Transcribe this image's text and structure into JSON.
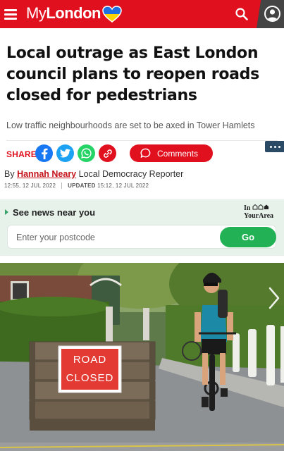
{
  "header": {
    "brand_my": "My",
    "brand_london": "London",
    "menu_icon": "hamburger-menu-icon",
    "search_icon": "search-icon",
    "account_icon": "user-account-icon",
    "brand_color": "#e0101e"
  },
  "article": {
    "headline": "Local outrage as East London council plans to reopen roads closed for pedestrians",
    "subheadline": "Low traffic neighbourhoods are set to be axed in Tower Hamlets",
    "byline_prefix": "By",
    "author": "Hannah Neary",
    "author_role": "Local Democracy Reporter",
    "published": "12:55, 12 JUL 2022",
    "updated_label": "UPDATED",
    "updated": "15:12, 12 JUL 2022"
  },
  "share": {
    "label": "SHARE",
    "comments_label": "Comments",
    "icons": [
      "facebook-icon",
      "twitter-icon",
      "whatsapp-icon",
      "copy-link-icon"
    ]
  },
  "news_near_you": {
    "title": "See news near you",
    "brand_in": "In",
    "brand_yourarea": "YourArea",
    "postcode_placeholder": "Enter your postcode",
    "go_label": "Go"
  },
  "hero": {
    "sign_line1": "ROAD",
    "sign_line2": "CLOSED"
  }
}
